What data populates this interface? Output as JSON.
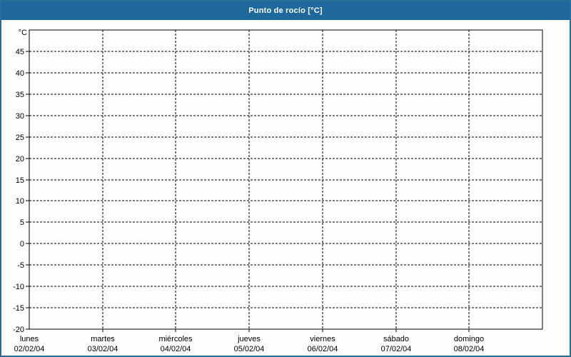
{
  "window": {
    "title": "Punto de rocío [°C]"
  },
  "colors": {
    "titlebar_bg": "#1E689B",
    "titlebar_text": "#FFFFFF",
    "frame_border": "#2B6D99",
    "body_bg": "#FDFEFC",
    "plot_bg": "#FEFEFE",
    "line_color": "#000000",
    "text_color": "#000000"
  },
  "chart_data": {
    "type": "line",
    "title": "Punto de rocío [°C]",
    "ylabel": "°C",
    "ylim": [
      -20,
      50
    ],
    "ytick_step": 5,
    "ytick_labels": [
      45,
      40,
      35,
      30,
      25,
      20,
      15,
      10,
      5,
      0,
      -5,
      -10,
      -15,
      -20
    ],
    "grid": "dashed",
    "legend": "none",
    "x_categories": [
      {
        "day": "lunes",
        "date": "02/02/04"
      },
      {
        "day": "martes",
        "date": "03/02/04"
      },
      {
        "day": "miércoles",
        "date": "04/02/04"
      },
      {
        "day": "jueves",
        "date": "05/02/04"
      },
      {
        "day": "viernes",
        "date": "06/02/04"
      },
      {
        "day": "sábado",
        "date": "07/02/04"
      },
      {
        "day": "domingo",
        "date": "08/02/04"
      }
    ],
    "series": []
  }
}
